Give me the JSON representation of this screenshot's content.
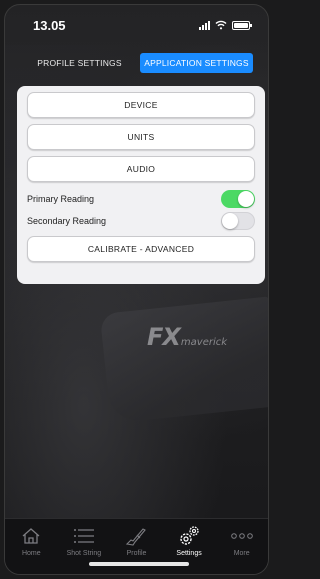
{
  "status_bar": {
    "time": "13.05",
    "icons": [
      "signal-icon",
      "wifi-icon",
      "battery-icon"
    ]
  },
  "tabs": [
    {
      "label": "PROFILE SETTINGS",
      "active": false
    },
    {
      "label": "APPLICATION SETTINGS",
      "active": true
    }
  ],
  "panel": {
    "device_label": "DEVICE",
    "units_label": "UNITS",
    "audio_label": "AUDIO",
    "primary_reading": {
      "label": "Primary Reading",
      "on": true
    },
    "secondary_reading": {
      "label": "Secondary Reading",
      "on": false
    },
    "calibrate_label": "CALIBRATE - ADVANCED"
  },
  "background_logo": {
    "main": "FX",
    "sub": "maverick"
  },
  "tabbar": [
    {
      "label": "Home",
      "icon": "home-icon",
      "selected": false
    },
    {
      "label": "Shot String",
      "icon": "list-icon",
      "selected": false
    },
    {
      "label": "Profile",
      "icon": "rifle-icon",
      "selected": false
    },
    {
      "label": "Settings",
      "icon": "gear-icon",
      "selected": true
    },
    {
      "label": "More",
      "icon": "more-icon",
      "selected": false
    }
  ],
  "colors": {
    "accent": "#1a8cff",
    "toggle_on": "#4cd964",
    "panel_bg": "#f1f1f3"
  }
}
